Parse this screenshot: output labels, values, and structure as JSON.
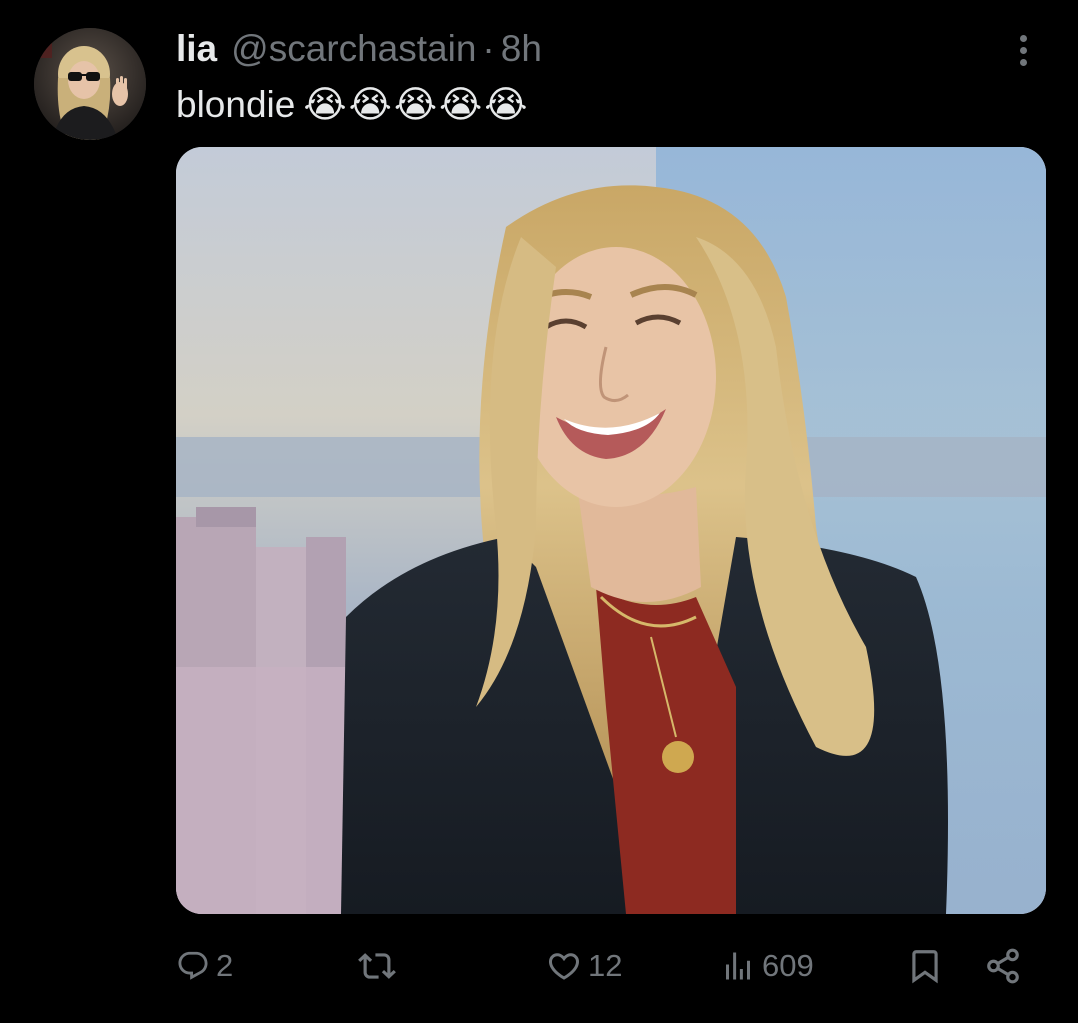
{
  "tweet": {
    "display_name": "lia",
    "handle": "@scarchastain",
    "separator": "·",
    "timestamp": "8h",
    "text": "blondie",
    "emojis": [
      "😭",
      "😭",
      "😭",
      "😭",
      "😭"
    ]
  },
  "actions": {
    "reply_count": "2",
    "retweet_count": "",
    "like_count": "12",
    "view_count": "609"
  },
  "colors": {
    "background": "#000000",
    "primary_text": "#e7e9ea",
    "secondary_text": "#71767b"
  },
  "icons": [
    "more-icon",
    "reply-icon",
    "retweet-icon",
    "like-icon",
    "views-icon",
    "bookmark-icon",
    "share-icon"
  ]
}
